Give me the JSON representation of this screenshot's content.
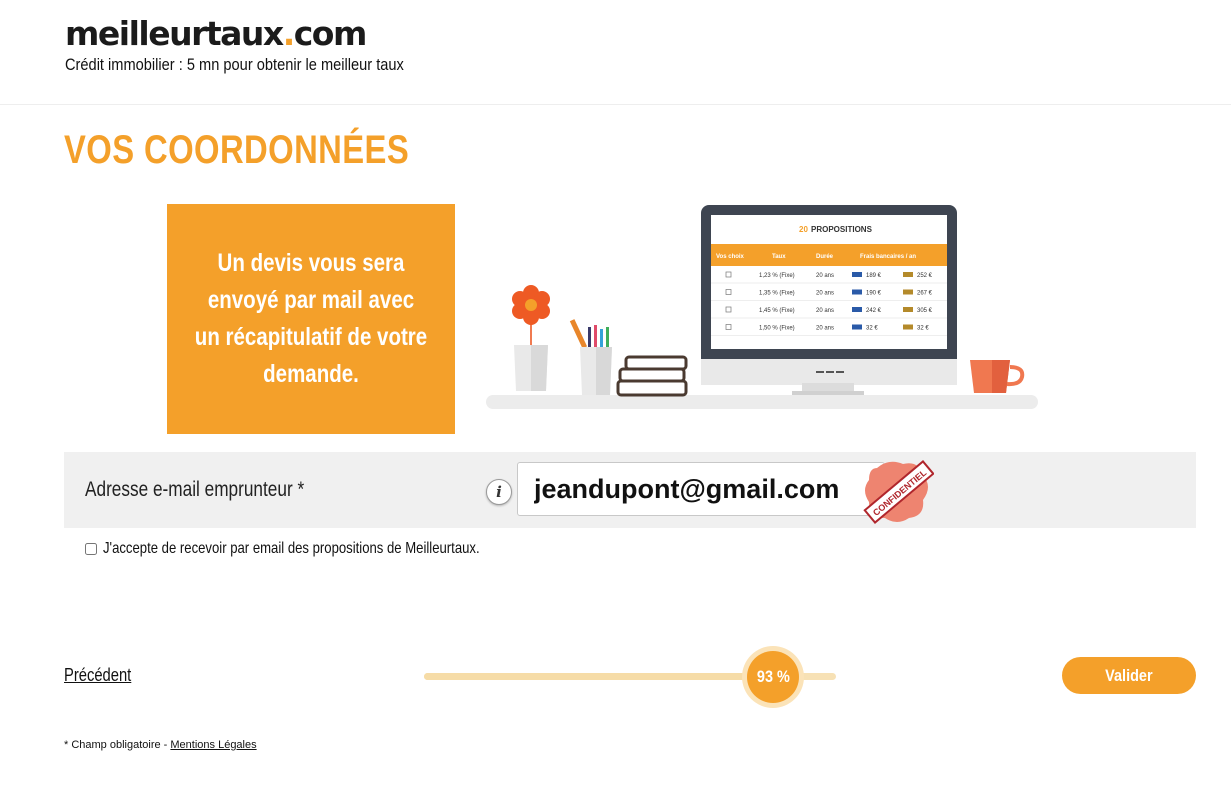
{
  "header": {
    "logo": {
      "main": "meilleurtaux",
      "dot": ".",
      "tld": "com"
    },
    "tagline": "Crédit immobilier : 5 mn pour obtenir le meilleur taux"
  },
  "page": {
    "title": "VOS COORDONNÉES"
  },
  "promo": {
    "text": "Un devis vous sera envoyé par mail avec un récapitulatif de votre demande."
  },
  "illustration": {
    "table_title_count": "20",
    "table_title": "PROPOSITIONS",
    "columns": [
      "Vos choix",
      "Taux",
      "Durée",
      "Frais bancaires / an"
    ],
    "rows": [
      [
        "1,23 % (Fixe)",
        "20 ans",
        "189 €",
        "252 €"
      ],
      [
        "1,35 % (Fixe)",
        "20 ans",
        "190 €",
        "267 €"
      ],
      [
        "1,45 % (Fixe)",
        "20 ans",
        "242 €",
        "305 €"
      ],
      [
        "1,50 % (Fixe)",
        "20 ans",
        "32 €",
        "32 €"
      ]
    ]
  },
  "form": {
    "email_label": "Adresse e-mail emprunteur *",
    "email_value": "jeandupont@gmail.com",
    "info_icon": "info-icon",
    "stamp_text": "CONFIDENTIEL",
    "consent_label": "J'accepte de recevoir par email des propositions de Meilleurtaux.",
    "consent_checked": false
  },
  "navigation": {
    "previous_label": "Précédent",
    "progress_value": 93,
    "progress_label": "93 %",
    "validate_label": "Valider"
  },
  "footer": {
    "required_note": "* Champ obligatoire - ",
    "legal_link": "Mentions Légales"
  },
  "colors": {
    "accent": "#f4a02a",
    "light_accent": "#fbe3b8",
    "row_bg": "#f0f0f0"
  }
}
